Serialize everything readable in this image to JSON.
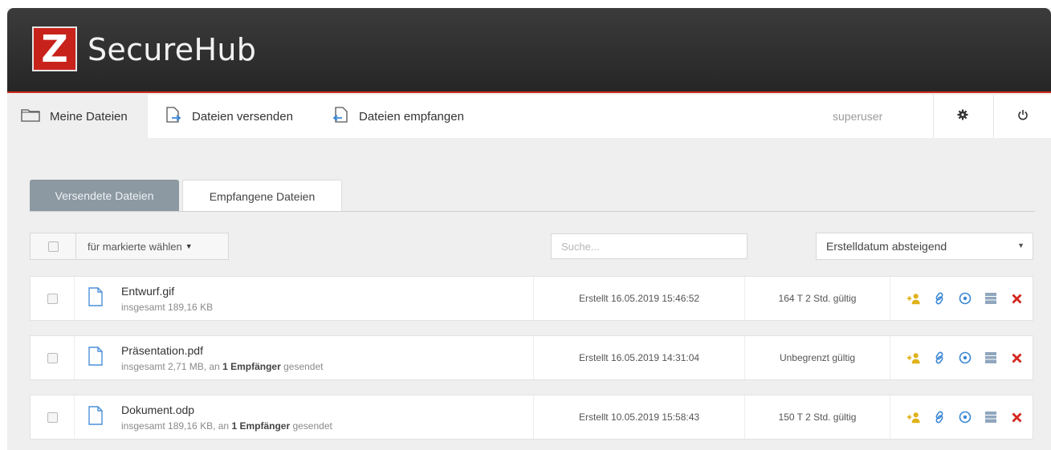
{
  "app": {
    "logo_letter": "Z",
    "title": "SecureHub"
  },
  "nav": {
    "items": [
      {
        "label": "Meine Dateien",
        "icon": "folder-icon",
        "active": true
      },
      {
        "label": "Dateien versenden",
        "icon": "file-send-icon"
      },
      {
        "label": "Dateien empfangen",
        "icon": "file-receive-icon"
      }
    ],
    "user": "superuser",
    "settings_icon": "gear-icon",
    "logout_icon": "power-icon"
  },
  "tabs": [
    {
      "label": "Versendete Dateien",
      "active": true
    },
    {
      "label": "Empfangene Dateien",
      "active": false
    }
  ],
  "toolbar": {
    "bulk_action_label": "für markierte wählen",
    "search_placeholder": "Suche...",
    "sort_selected": "Erstelldatum absteigend"
  },
  "files": [
    {
      "name": "Entwurf.gif",
      "meta_prefix": "insgesamt 189,16 KB",
      "meta_mid": "",
      "meta_bold": "",
      "meta_suffix": "",
      "created": "Erstellt 16.05.2019 15:46:52",
      "validity": "164 T 2 Std. gültig"
    },
    {
      "name": "Präsentation.pdf",
      "meta_prefix": "insgesamt 2,71 MB",
      "meta_mid": ", an ",
      "meta_bold": "1 Empfänger",
      "meta_suffix": " gesendet",
      "created": "Erstellt 16.05.2019 14:31:04",
      "validity": "Unbegrenzt gültig"
    },
    {
      "name": "Dokument.odp",
      "meta_prefix": "insgesamt 189,16 KB",
      "meta_mid": ", an ",
      "meta_bold": "1 Empfänger",
      "meta_suffix": " gesendet",
      "created": "Erstellt 10.05.2019 15:58:43",
      "validity": "150 T 2 Std. gültig"
    }
  ],
  "row_actions": [
    "add-user-icon",
    "link-icon",
    "info-icon",
    "list-icon",
    "delete-icon"
  ],
  "colors": {
    "brand_red": "#c8231b",
    "header_dark": "#2e2e2e",
    "active_tab": "#8c99a3",
    "action_yellow": "#e0b21a",
    "action_blue": "#3a86d4",
    "delete_red": "#d3261e"
  }
}
